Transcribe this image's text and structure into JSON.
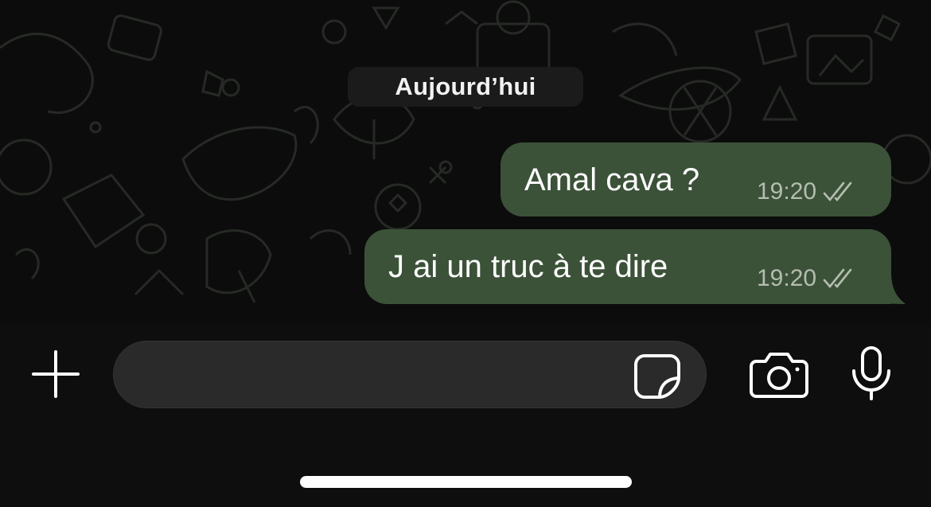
{
  "chat": {
    "date_separator": "Aujourd’hui",
    "messages": [
      {
        "text": "Amal cava ?",
        "time": "19:20",
        "status": "read-double-check-icon"
      },
      {
        "text": "J ai un truc à te dire",
        "time": "19:20",
        "status": "read-double-check-icon"
      }
    ]
  },
  "composer": {
    "input_value": "",
    "icons": [
      "plus-icon",
      "sticker-icon",
      "camera-icon",
      "microphone-icon"
    ]
  },
  "colors": {
    "background": "#0c0c0c",
    "outgoing_bubble": "#3b5238",
    "input_field": "#2a2a2a",
    "meta_text": "#b4bdb0"
  }
}
